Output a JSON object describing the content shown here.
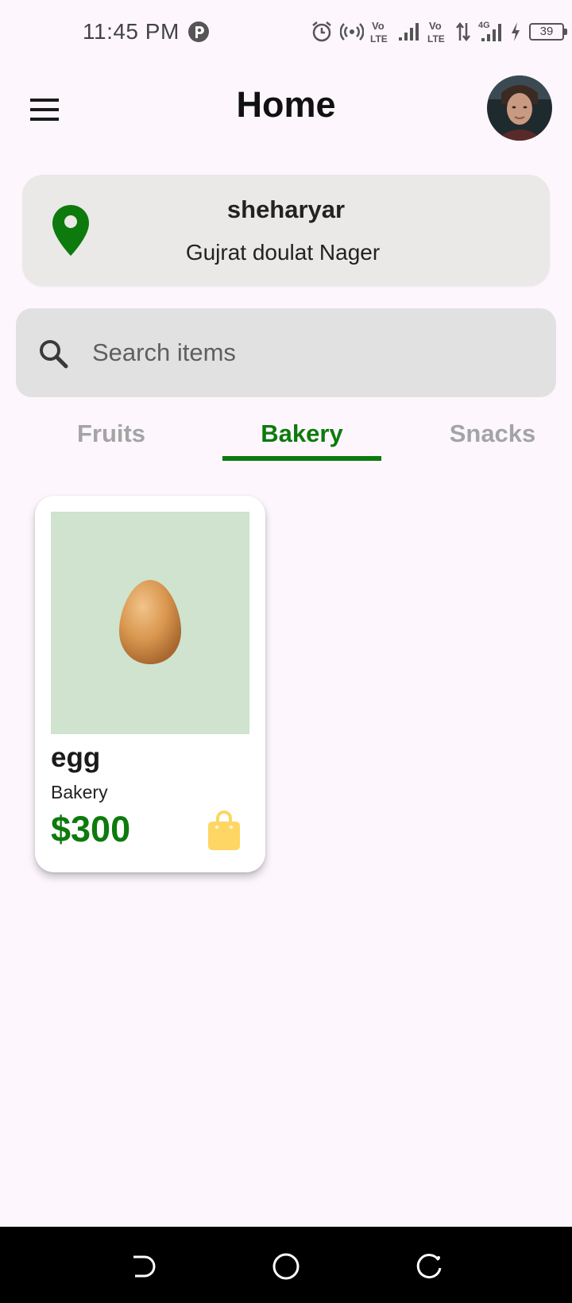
{
  "status_bar": {
    "time": "11:45 PM",
    "battery": "39",
    "icons": [
      "app-notification-icon",
      "alarm-icon",
      "hotspot-icon",
      "volte-icon",
      "signal-icon",
      "volte-icon",
      "data-transfer-icon",
      "4g-signal-icon",
      "charging-icon",
      "battery-icon"
    ]
  },
  "header": {
    "title": "Home",
    "menu_icon": "hamburger-menu-icon",
    "avatar_icon": "user-avatar"
  },
  "location": {
    "name": "sheharyar",
    "address": "Gujrat doulat Nager",
    "icon": "location-pin-icon",
    "accent": "#0d7a0d"
  },
  "search": {
    "placeholder": "Search items",
    "value": "",
    "icon": "search-icon"
  },
  "tabs": [
    {
      "label": "Fruits",
      "selected": false
    },
    {
      "label": "Bakery",
      "selected": true
    },
    {
      "label": "Snacks",
      "selected": false
    }
  ],
  "products": [
    {
      "name": "egg",
      "category": "Bakery",
      "price": "$300",
      "image": "egg-image",
      "action_icon": "shopping-bag-icon",
      "action_color": "#fdd663"
    }
  ],
  "nav_bar": {
    "buttons": [
      "back-icon",
      "home-icon",
      "recent-apps-icon"
    ]
  },
  "colors": {
    "background": "#fdf7fd",
    "accent_green": "#0d7a0d",
    "tab_inactive": "#a4a4a4",
    "card_bg": "#ebe8e8",
    "search_bg": "#e2e1e1",
    "image_bg": "#cfe3cf"
  }
}
